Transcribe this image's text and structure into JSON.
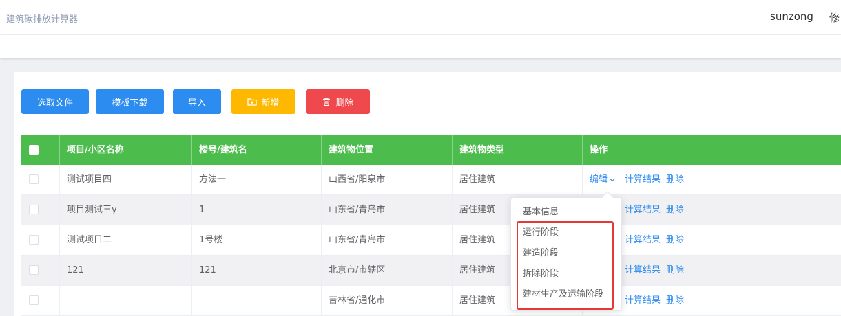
{
  "header": {
    "app_title": "建筑碳排放计算器",
    "user_name": "sunzong",
    "user_extra": "修"
  },
  "toolbar": {
    "select_file": "选取文件",
    "template_download": "模板下载",
    "import": "导入",
    "add": "新增",
    "delete": "删除"
  },
  "table": {
    "columns": [
      "项目/小区名称",
      "楼号/建筑名",
      "建筑物位置",
      "建筑物类型",
      "操作"
    ],
    "rows": [
      {
        "project": "测试项目四",
        "building": "方法一",
        "location": "山西省/阳泉市",
        "type": "居住建筑"
      },
      {
        "project": "项目测试三y",
        "building": "1",
        "location": "山东省/青岛市",
        "type": "居住建筑"
      },
      {
        "project": "测试项目二",
        "building": "1号楼",
        "location": "山东省/青岛市",
        "type": "居住建筑"
      },
      {
        "project": "121",
        "building": "121",
        "location": "北京市/市辖区",
        "type": "居住建筑"
      },
      {
        "project": "",
        "building": "",
        "location": "吉林省/通化市",
        "type": "居住建筑"
      }
    ],
    "ops": {
      "edit": "编辑",
      "result": "计算结果",
      "delete": "删除"
    }
  },
  "dropdown": {
    "items": [
      "基本信息",
      "运行阶段",
      "建造阶段",
      "拆除阶段",
      "建材生产及运输阶段"
    ]
  },
  "colors": {
    "primary": "#2d8cf0",
    "header_green": "#4cbc4d",
    "warning": "#ffb800",
    "danger": "#f0494d",
    "highlight": "#e53935"
  }
}
